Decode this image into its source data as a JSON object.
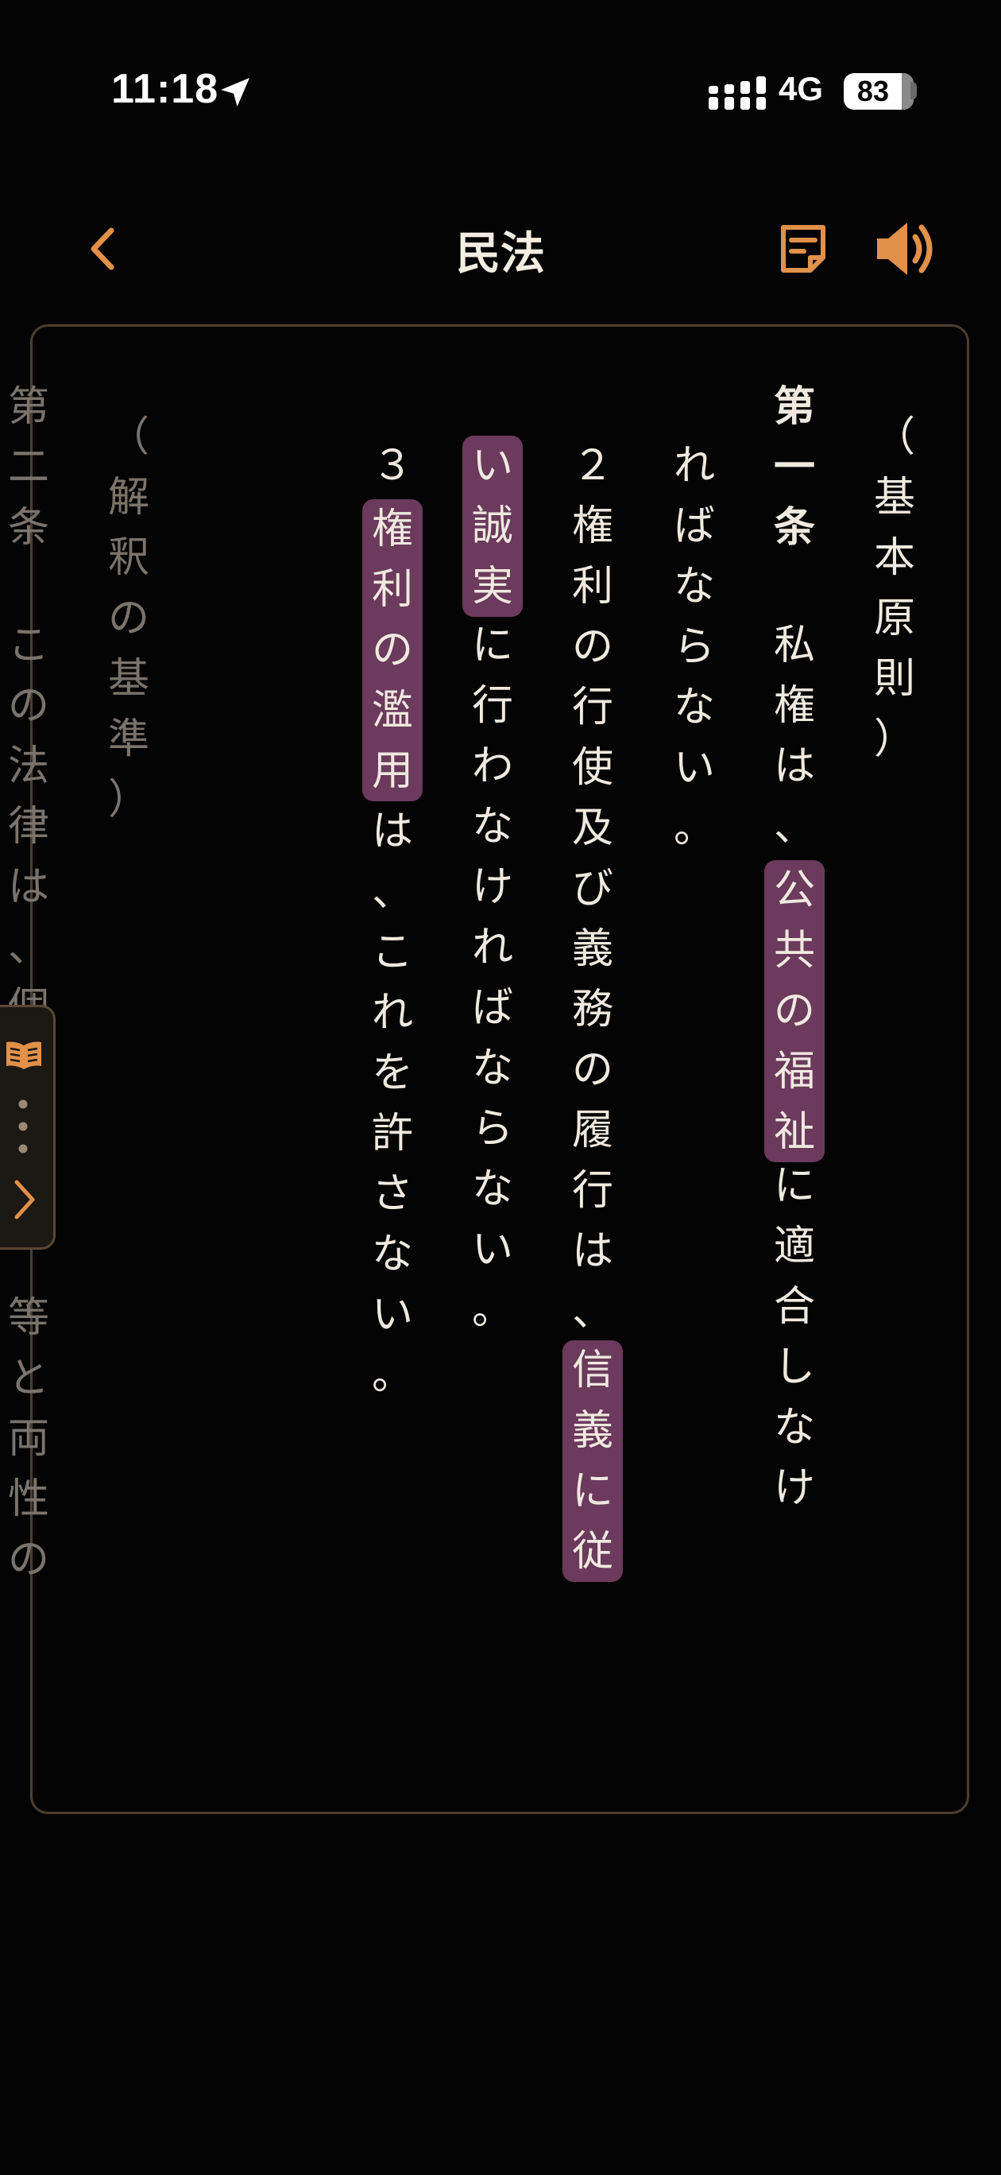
{
  "status_bar": {
    "time": "11:18",
    "network": "4G",
    "battery": "83",
    "battery_level": 0.83
  },
  "nav": {
    "title": "民法",
    "back_icon": "chevron-left-icon",
    "memo_icon": "memo-icon",
    "sound_icon": "speaker-icon"
  },
  "colors": {
    "accent": "#e1914a",
    "highlight": "#6b3a5c",
    "background": "#050404",
    "text": "#efe9df"
  },
  "text": {
    "col0": "（基本原則）",
    "col1a": "第一条",
    "col1b": "私権は、",
    "col1c": "公共の福祉",
    "col1d": "に適合しなけ",
    "col2": "ればならない。",
    "col3a": "２権利の行使及び義務の履行は、",
    "col3b": "信義に従",
    "col4a": "い誠実",
    "col4b": "に行わなければならない。",
    "col5a": "３",
    "col5b": "権利の濫用",
    "col5c": "は、これを許さない。",
    "col6": "（解釈の基準）",
    "col7a": "第二条",
    "col7b": "この法律は、個",
    "col7c": "等と両性の"
  }
}
